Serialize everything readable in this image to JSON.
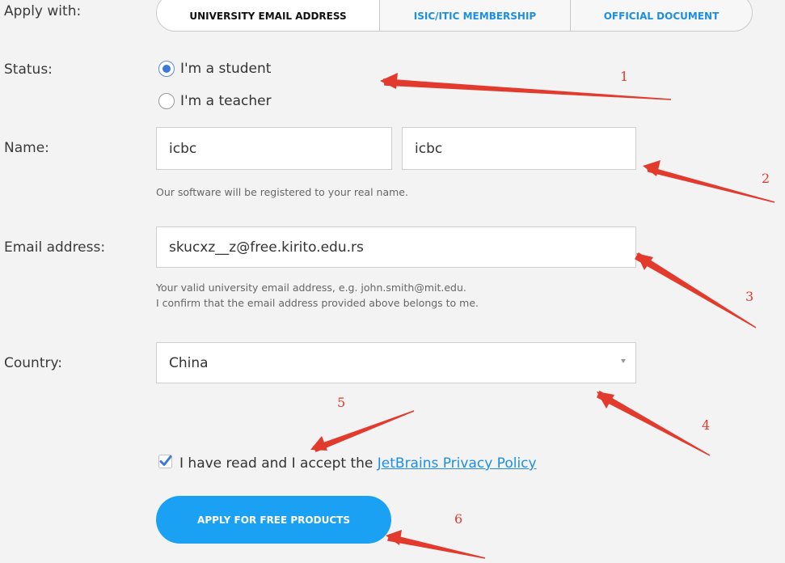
{
  "labels": {
    "apply_with": "Apply with:",
    "status": "Status:",
    "name": "Name:",
    "email": "Email address:",
    "country": "Country:"
  },
  "tabs": [
    {
      "label": "UNIVERSITY EMAIL ADDRESS",
      "active": true
    },
    {
      "label": "ISIC/ITIC MEMBERSHIP",
      "active": false
    },
    {
      "label": "OFFICIAL DOCUMENT",
      "active": false
    }
  ],
  "status_options": [
    {
      "label": "I'm a student",
      "selected": true
    },
    {
      "label": "I'm a teacher",
      "selected": false
    }
  ],
  "name": {
    "first": "icbc",
    "last": "icbc",
    "help": "Our software will be registered to your real name."
  },
  "email": {
    "value": "skucxz__z@free.kirito.edu.rs",
    "help_line1": "Your valid university email address, e.g. john.smith@mit.edu.",
    "help_line2": "I confirm that the email address provided above belongs to me."
  },
  "country": {
    "selected": "China"
  },
  "privacy": {
    "checked": true,
    "text": "I have read and I accept the ",
    "link": "JetBrains Privacy Policy"
  },
  "apply_button": "APPLY FOR FREE PRODUCTS",
  "annotations": [
    "1",
    "2",
    "3",
    "4",
    "5",
    "6"
  ],
  "colors": {
    "accent": "#1aa1f4",
    "link": "#1e8fe0",
    "annotation": "#e23b2e",
    "radio_selected": "#3c78d8"
  }
}
